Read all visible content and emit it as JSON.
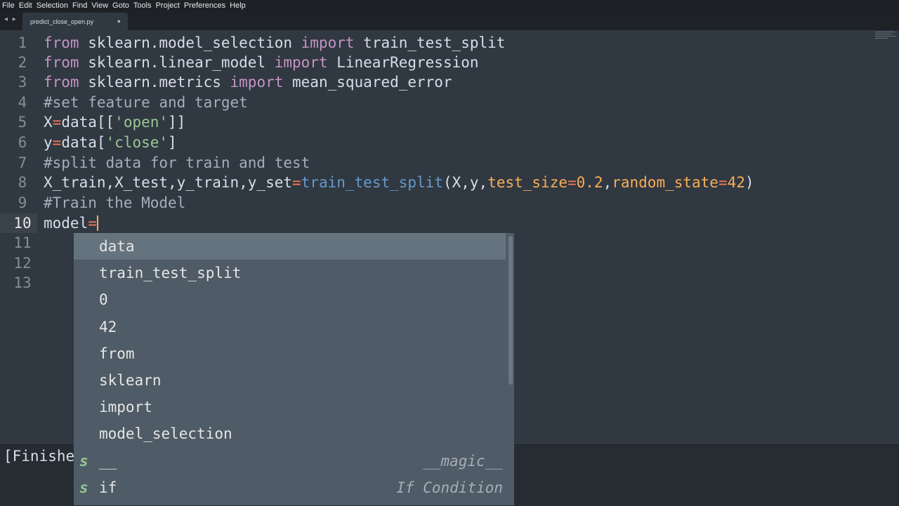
{
  "menu": [
    "File",
    "Edit",
    "Selection",
    "Find",
    "View",
    "Goto",
    "Tools",
    "Project",
    "Preferences",
    "Help"
  ],
  "tab": {
    "nav": "◂ ▸",
    "filename": "predict_close_open.py",
    "dirty_mark": "●"
  },
  "editor": {
    "line_numbers": [
      "1",
      "2",
      "3",
      "4",
      "5",
      "6",
      "7",
      "8",
      "9",
      "10",
      "11",
      "12",
      "13"
    ],
    "current_line": "10",
    "code": {
      "l1": {
        "kw1": "from",
        "mod": " sklearn.model_selection ",
        "kw2": "import",
        "name": " train_test_split"
      },
      "l2": {
        "kw1": "from",
        "mod": " sklearn.linear_model ",
        "kw2": "import",
        "name": " LinearRegression"
      },
      "l3": {
        "kw1": "from",
        "mod": " sklearn.metrics ",
        "kw2": "import",
        "name": " mean_squared_error"
      },
      "l4": "#set feature and target",
      "l5": {
        "var": "X",
        "op": "=",
        "a": "data[[",
        "s": "'open'",
        "b": "]]"
      },
      "l6": {
        "var": "y",
        "op": "=",
        "a": "data[",
        "s": "'close'",
        "b": "]"
      },
      "l7": "#split data for train and test",
      "l8": {
        "lhs": "X_train,X_test,y_train,y_set",
        "op": "=",
        "fn": "train_test_split",
        "args1": "(X,y,",
        "k1": "test_size",
        "eq1": "=",
        "v1": "0.2",
        "c": ",",
        "k2": "random_state",
        "eq2": "=",
        "v2": "42",
        "close": ")"
      },
      "l9": "#Train the Model",
      "l10": {
        "var": "model",
        "op": "="
      }
    }
  },
  "output": {
    "text": "[Finished"
  },
  "autocomplete": {
    "items": [
      {
        "label": "data",
        "kind": "",
        "detail": ""
      },
      {
        "label": "train_test_split",
        "kind": "",
        "detail": ""
      },
      {
        "label": "0",
        "kind": "",
        "detail": ""
      },
      {
        "label": "42",
        "kind": "",
        "detail": ""
      },
      {
        "label": "from",
        "kind": "",
        "detail": ""
      },
      {
        "label": "sklearn",
        "kind": "",
        "detail": ""
      },
      {
        "label": "import",
        "kind": "",
        "detail": ""
      },
      {
        "label": "model_selection",
        "kind": "",
        "detail": ""
      },
      {
        "label": "__",
        "kind": "s",
        "detail": "__magic__"
      },
      {
        "label": "if",
        "kind": "s",
        "detail": "If Condition"
      }
    ],
    "selected_index": 0
  },
  "colors": {
    "background": "#303841",
    "keyword": "#c594c5",
    "comment": "#a7adba",
    "string": "#99c794",
    "operator": "#f97b58",
    "function": "#6699cc",
    "number": "#f9ae58"
  }
}
